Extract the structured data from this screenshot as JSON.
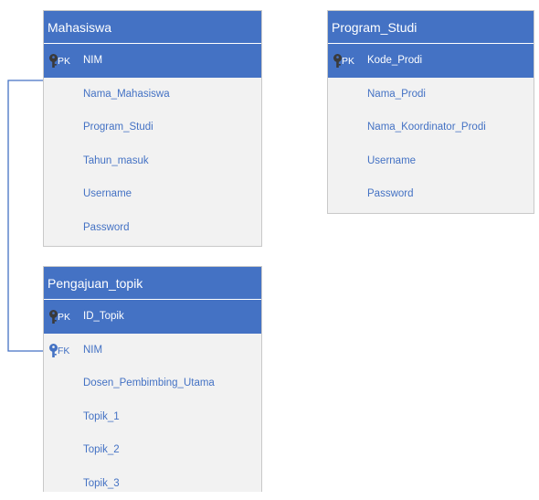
{
  "tables": {
    "mahasiswa": {
      "title": "Mahasiswa",
      "fields": [
        {
          "key": "PK",
          "name": "NIM"
        },
        {
          "key": "",
          "name": "Nama_Mahasiswa"
        },
        {
          "key": "",
          "name": "Program_Studi"
        },
        {
          "key": "",
          "name": "Tahun_masuk"
        },
        {
          "key": "",
          "name": "Username"
        },
        {
          "key": "",
          "name": "Password"
        }
      ]
    },
    "program_studi": {
      "title": "Program_Studi",
      "fields": [
        {
          "key": "PK",
          "name": "Kode_Prodi"
        },
        {
          "key": "",
          "name": "Nama_Prodi"
        },
        {
          "key": "",
          "name": "Nama_Koordinator_Prodi"
        },
        {
          "key": "",
          "name": "Username"
        },
        {
          "key": "",
          "name": "Password"
        }
      ]
    },
    "pengajuan_topik": {
      "title": "Pengajuan_topik",
      "fields": [
        {
          "key": "PK",
          "name": "ID_Topik"
        },
        {
          "key": "FK",
          "name": "NIM"
        },
        {
          "key": "",
          "name": "Dosen_Pembimbing_Utama"
        },
        {
          "key": "",
          "name": "Topik_1"
        },
        {
          "key": "",
          "name": "Topik_2"
        },
        {
          "key": "",
          "name": "Topik_3"
        }
      ]
    }
  },
  "colors": {
    "header": "#4472c4",
    "body": "#f2f2f2",
    "text": "#4472c4",
    "key_icon_pk": "#3a3a3a",
    "key_icon_fk": "#4472c4",
    "connector": "#4472c4"
  },
  "icons": {
    "key": "key-icon"
  }
}
